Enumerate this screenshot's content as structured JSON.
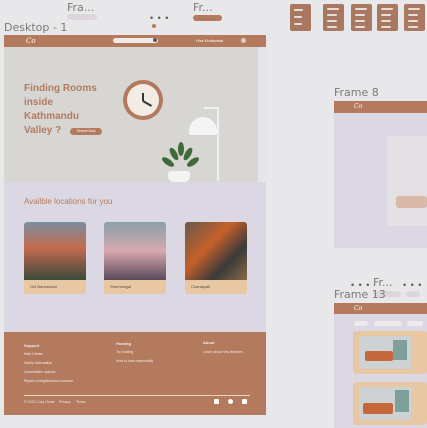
{
  "canvas": {
    "frames": {
      "top_left": "Fra...",
      "top_middle": "Fr...",
      "desktop": "Desktop - 1",
      "frame8": "Frame 8",
      "frame13": "Frame 13",
      "small_fr": "Fr..."
    }
  },
  "desktop": {
    "logo": "Co",
    "nav_right": "Hira Khatiwada",
    "hero": {
      "title": "Finding Rooms inside Kathmandu Valley ?",
      "button": "Search Now"
    },
    "section_title": "Availble locations for you",
    "cards": [
      {
        "label": "Old Baneshwor"
      },
      {
        "label": "Sherminigal"
      },
      {
        "label": "Chaniapati"
      }
    ],
    "footer": {
      "support_title": "Support",
      "support_items": [
        "Help Center",
        "Safety information",
        "Cancellation options",
        "Report a neighborhood concern"
      ],
      "hosting_title": "Hosting",
      "hosting_items": [
        "Try hosting",
        "How to host responsibly"
      ],
      "about_title": "About",
      "about_items": [
        "Learn about new features"
      ],
      "copyright": "© 2021 Cozy Home",
      "privacy": "Privacy",
      "terms": "Terms"
    }
  },
  "colors": {
    "brand": "#b37a5e",
    "card": "#e8c7a3",
    "background": "#dcd8e3"
  }
}
